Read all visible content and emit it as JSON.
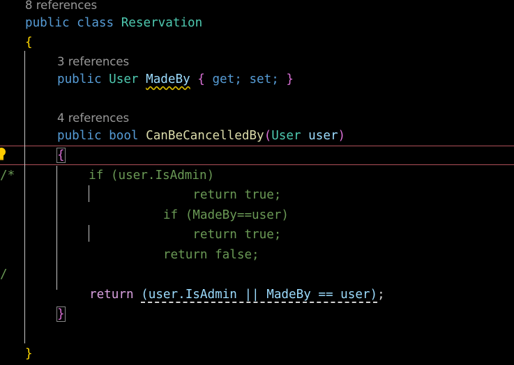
{
  "codelens": {
    "class_refs": "8 references",
    "prop_refs": "3 references",
    "method_refs": "4 references"
  },
  "tokens": {
    "public": "public",
    "class": "class",
    "class_name": "Reservation",
    "open_brace": "{",
    "close_brace": "}",
    "user_type": "User",
    "made_by": "MadeBy",
    "get": "get;",
    "set": "set;",
    "bool": "bool",
    "method_name": "CanBeCancelledBy",
    "open_paren": "(",
    "close_paren": ")",
    "param_name": "user",
    "return_kw": "return",
    "return_expr": "(user.IsAdmin || MadeBy == user)",
    "semicolon": ";"
  },
  "comment_lines": [
    "/*          if (user.IsAdmin)",
    "              return true;",
    "          if (MadeBy==user)",
    "              return true;",
    "          return false;",
    "/"
  ],
  "icons": {
    "lightbulb": "lightbulb-icon"
  }
}
